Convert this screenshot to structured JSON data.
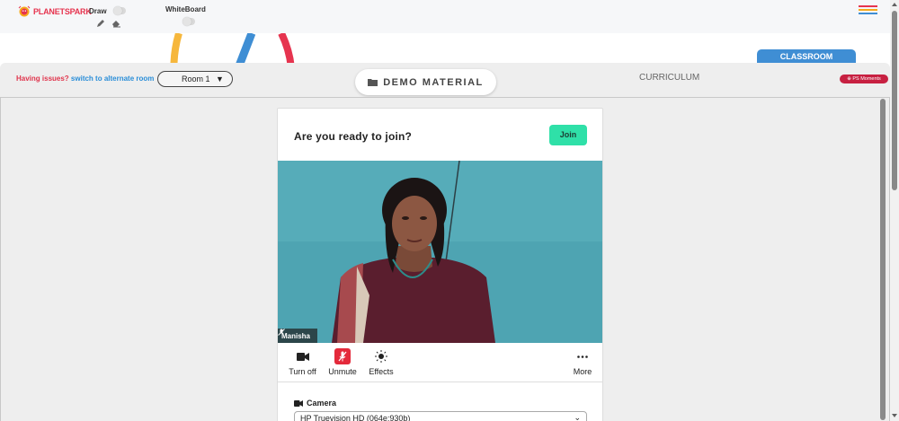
{
  "brand": {
    "logo_text_a": "PLANET",
    "logo_text_b": "SPARK",
    "logo_icon": "planet-spark-logo"
  },
  "toolbar": {
    "draw_label": "Draw",
    "draw_icons": [
      "pencil-icon",
      "eraser-icon"
    ],
    "whiteboard_label": "WhiteBoard",
    "menu_icon": "hamburger-menu-icon",
    "menu_colors": [
      "#e6344f",
      "#f6a91b",
      "#3f8ed4"
    ]
  },
  "tabs": {
    "classroom": "CLASSROOM",
    "demo_material": "DEMO MATERIAL",
    "curriculum": "CURRICULUM",
    "ps_moments": "PS Moments"
  },
  "issues": {
    "prefix": "Having issues?",
    "link": "switch to alternate room"
  },
  "room": {
    "selected": "Room 1"
  },
  "prejoin": {
    "title": "Are you ready to join?",
    "join_label": "Join",
    "participant_name": "Manisha",
    "controls": [
      {
        "label": "Turn off",
        "icon": "video-camera-icon"
      },
      {
        "label": "Unmute",
        "icon": "mic-off-icon"
      },
      {
        "label": "Effects",
        "icon": "sun-icon"
      },
      {
        "label": "More",
        "icon": "more-dots-icon"
      }
    ],
    "camera_label": "Camera",
    "camera_value": "HP Truevision HD (064e:930b)"
  },
  "colors": {
    "accent_blue": "#3f8ed4",
    "join_green": "#2fe0a8",
    "unmute_red": "#e42a3b",
    "brand_red": "#e6344f"
  }
}
